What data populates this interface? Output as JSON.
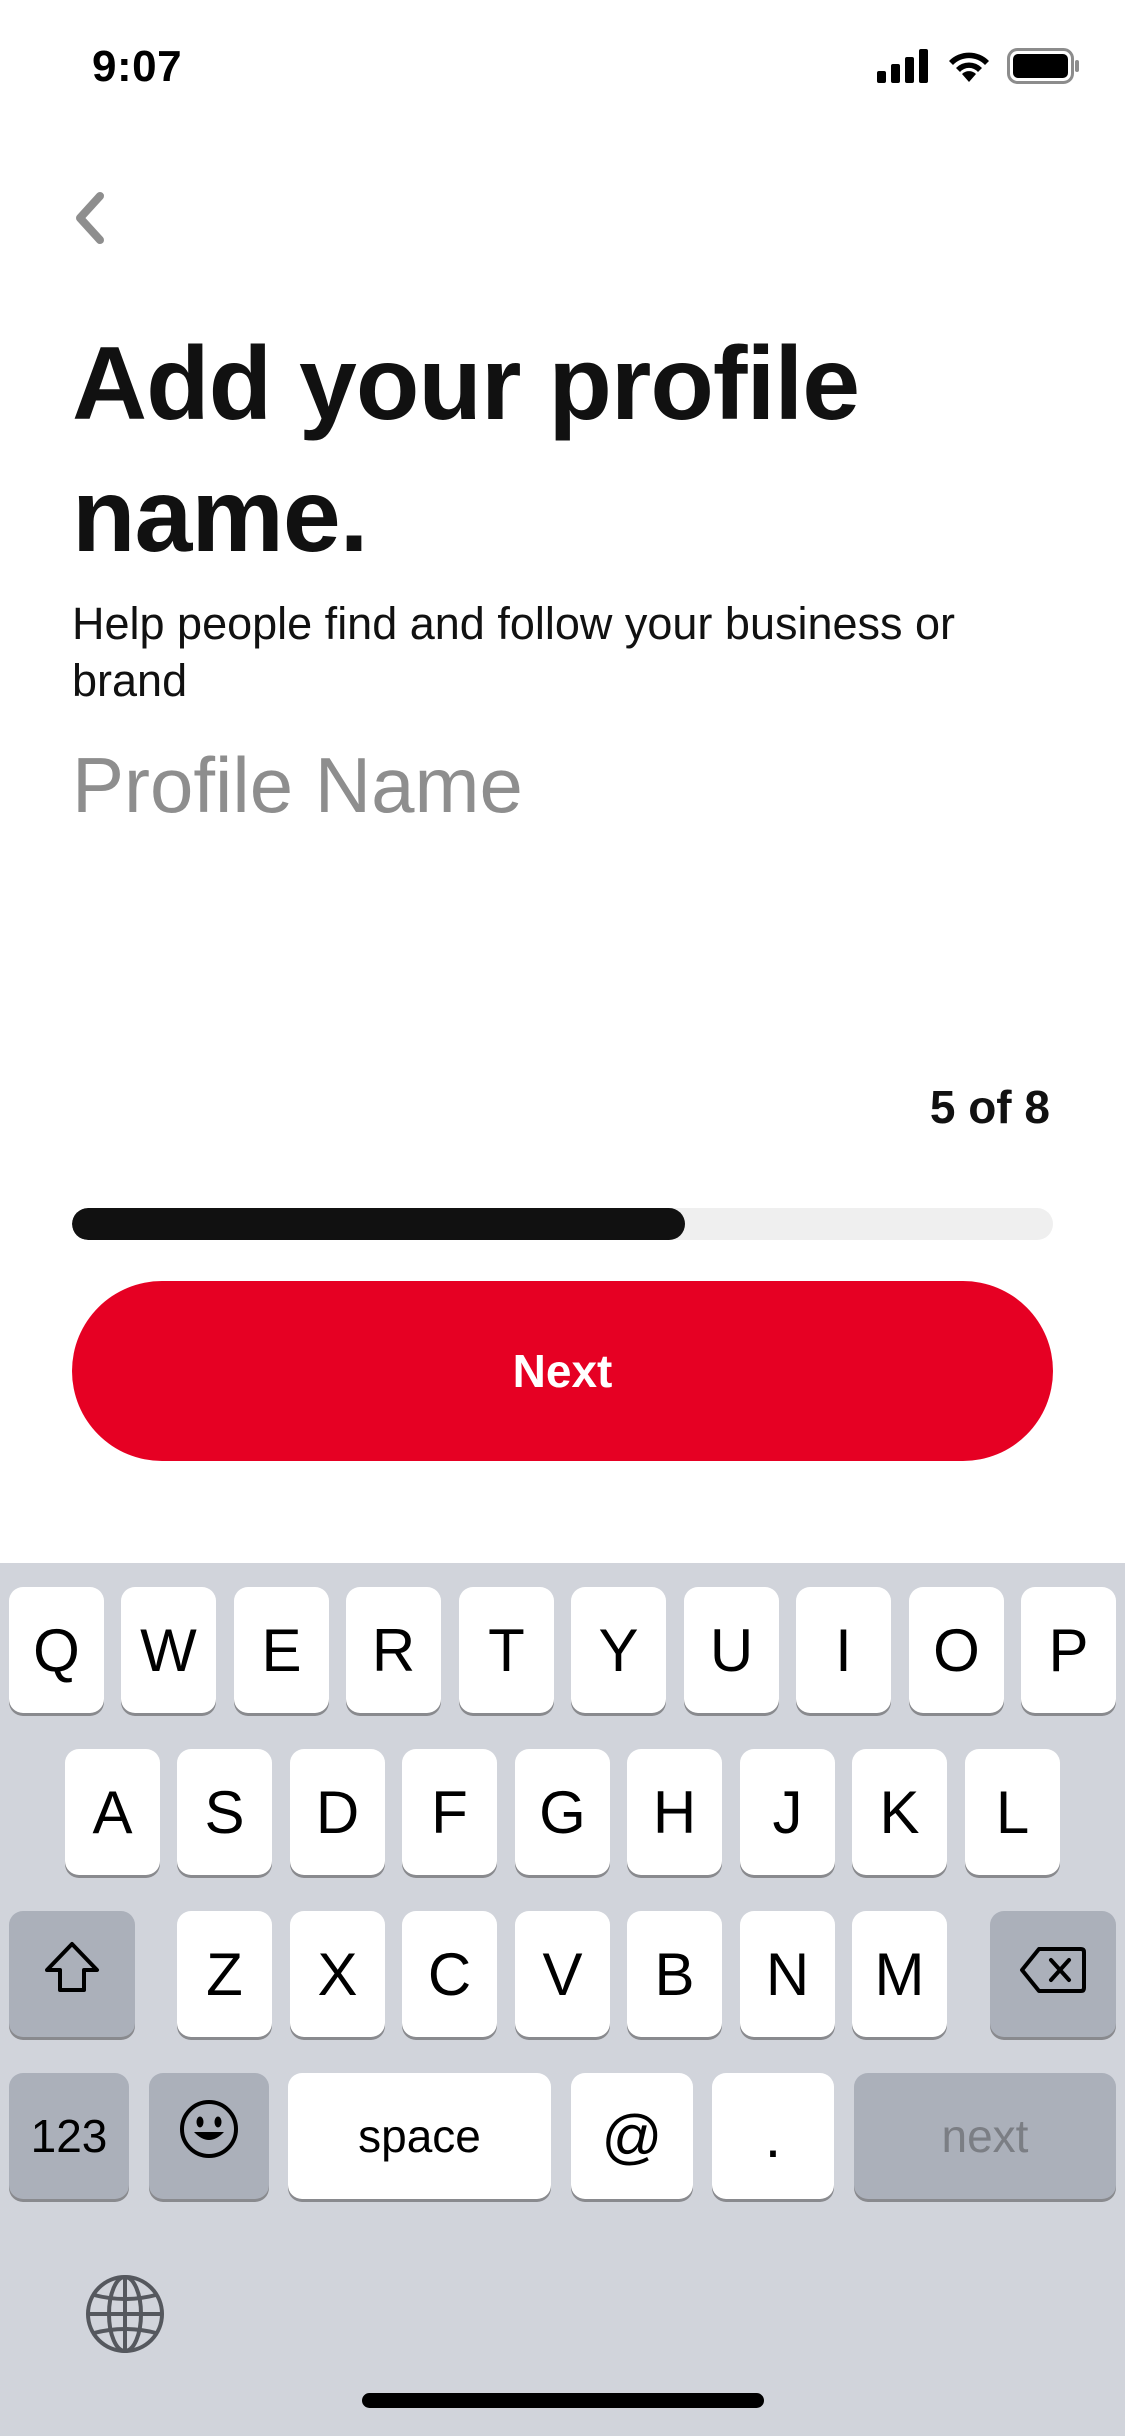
{
  "status_bar": {
    "time": "9:07",
    "icons": [
      "cellular-signal-icon",
      "wifi-icon",
      "battery-icon"
    ]
  },
  "header": {
    "back_icon": "chevron-left-icon"
  },
  "title": "Add your profile name.",
  "subtitle": "Help people find and follow your business or brand",
  "profile_input": {
    "placeholder": "Profile Name",
    "value": ""
  },
  "progress": {
    "step_label": "5 of 8",
    "current": 5,
    "total": 8,
    "fill_fraction": 0.625,
    "fill_color": "#111111",
    "track_color": "#efefef"
  },
  "next_button": {
    "label": "Next",
    "color": "#e60023"
  },
  "keyboard": {
    "row1": [
      "Q",
      "W",
      "E",
      "R",
      "T",
      "Y",
      "U",
      "I",
      "O",
      "P"
    ],
    "row2": [
      "A",
      "S",
      "D",
      "F",
      "G",
      "H",
      "J",
      "K",
      "L"
    ],
    "row3": [
      "Z",
      "X",
      "C",
      "V",
      "B",
      "N",
      "M"
    ],
    "shift_icon": "shift-icon",
    "delete_icon": "delete-icon",
    "numbers_label": "123",
    "emoji_icon": "emoji-icon",
    "space_label": "space",
    "at_label": "@",
    "period_label": ".",
    "return_label": "next",
    "globe_icon": "globe-icon"
  }
}
